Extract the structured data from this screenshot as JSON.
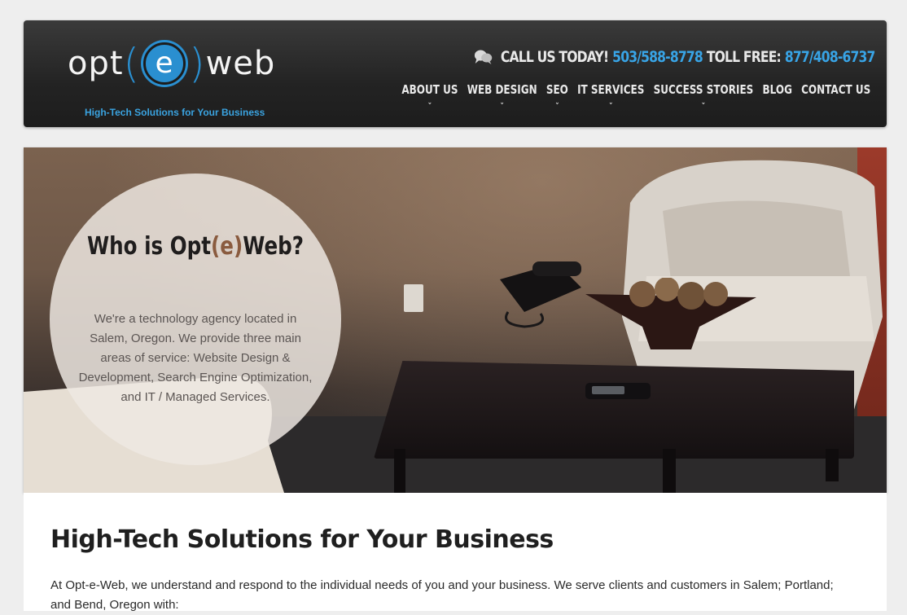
{
  "header": {
    "logo": {
      "before": "opt(",
      "letter": "e",
      "after": ")web",
      "tagline": "High-Tech Solutions for Your Business"
    },
    "callbar": {
      "icon": "chat-bubbles-icon",
      "call_label": "CALL US TODAY!",
      "call_number": "503/588-8778",
      "tollfree_label": "TOLL FREE:",
      "tollfree_number": "877/408-6737"
    },
    "nav": [
      {
        "label": "ABOUT US",
        "has_dropdown": true
      },
      {
        "label": "WEB DESIGN",
        "has_dropdown": true
      },
      {
        "label": "SEO",
        "has_dropdown": true
      },
      {
        "label": "IT SERVICES",
        "has_dropdown": true
      },
      {
        "label": "SUCCESS STORIES",
        "has_dropdown": true
      },
      {
        "label": "BLOG",
        "has_dropdown": false
      },
      {
        "label": "CONTACT US",
        "has_dropdown": false
      }
    ]
  },
  "hero": {
    "title_prefix": "Who is Opt",
    "title_accent": "(e)",
    "title_suffix": "Web?",
    "body": "We're a technology agency located in Salem, Oregon. We provide three main areas of service: Website Design & Development, Search Engine Optimization, and IT / Managed Services."
  },
  "content": {
    "title": "High-Tech Solutions for Your Business",
    "intro": "At Opt-e-Web, we understand and respond to the individual needs of you and your business. We serve clients and customers in Salem; Portland; and Bend, Oregon with:"
  },
  "colors": {
    "accent_blue": "#38a4e6",
    "header_dark": "#2a2a2a",
    "title_accent_brown": "#8a5b3f"
  }
}
